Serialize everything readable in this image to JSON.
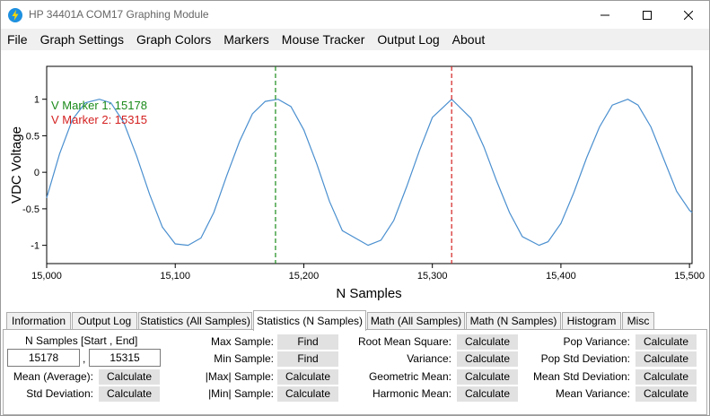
{
  "window": {
    "title": "HP 34401A COM17 Graphing Module",
    "accent": "#1e90e0"
  },
  "menu": [
    "File",
    "Graph Settings",
    "Graph Colors",
    "Markers",
    "Mouse Tracker",
    "Output Log",
    "About"
  ],
  "chart_data": {
    "type": "line",
    "xlabel": "N Samples",
    "ylabel": "VDC Voltage",
    "xlim": [
      15000,
      15502
    ],
    "ylim": [
      -1.25,
      1.45
    ],
    "xticks": [
      15000,
      15100,
      15200,
      15300,
      15400,
      15500
    ],
    "xtick_labels": [
      "15,000",
      "15,100",
      "15,200",
      "15,300",
      "15,400",
      "15,500"
    ],
    "yticks": [
      1,
      0.5,
      0,
      -0.5,
      -1
    ],
    "ytick_labels": [
      "1",
      "0.5",
      "0",
      "-0.5",
      "-1"
    ],
    "grid": false,
    "series": [
      {
        "color": "#4a8fcf",
        "x": [
          15000,
          15010,
          15020,
          15030,
          15041,
          15050,
          15060,
          15070,
          15080,
          15090,
          15100,
          15110,
          15120,
          15130,
          15140,
          15150,
          15160,
          15170,
          15180,
          15190,
          15200,
          15210,
          15220,
          15230,
          15250,
          15260,
          15270,
          15280,
          15290,
          15300,
          15315,
          15330,
          15340,
          15350,
          15360,
          15370,
          15383,
          15390,
          15400,
          15410,
          15420,
          15430,
          15440,
          15452,
          15460,
          15470,
          15480,
          15490,
          15500,
          15502
        ],
        "y": [
          -0.35,
          0.25,
          0.72,
          0.95,
          1.0,
          0.95,
          0.68,
          0.22,
          -0.3,
          -0.75,
          -0.98,
          -1.0,
          -0.9,
          -0.55,
          -0.05,
          0.42,
          0.8,
          0.97,
          1.0,
          0.9,
          0.58,
          0.12,
          -0.4,
          -0.8,
          -1.0,
          -0.93,
          -0.66,
          -0.2,
          0.3,
          0.75,
          1.0,
          0.74,
          0.35,
          -0.12,
          -0.55,
          -0.88,
          -1.0,
          -0.95,
          -0.7,
          -0.28,
          0.2,
          0.62,
          0.92,
          1.0,
          0.92,
          0.62,
          0.18,
          -0.26,
          -0.52,
          -0.55
        ]
      }
    ],
    "markers": [
      {
        "label": "V Marker 1: 15178",
        "x": 15178,
        "color": "#1a8a1a"
      },
      {
        "label": "V Marker 2: 15315",
        "x": 15315,
        "color": "#d42020"
      }
    ]
  },
  "tabs": [
    {
      "label": "Information",
      "active": false
    },
    {
      "label": "Output Log",
      "active": false
    },
    {
      "label": "Statistics (All Samples)",
      "active": false
    },
    {
      "label": "Statistics (N Samples)",
      "active": true
    },
    {
      "label": "Math (All Samples)",
      "active": false
    },
    {
      "label": "Math (N Samples)",
      "active": false
    },
    {
      "label": "Histogram",
      "active": false
    },
    {
      "label": "Misc",
      "active": false
    }
  ],
  "panel": {
    "range_label": "N Samples [Start , End]",
    "start_value": "15178",
    "separator": ",",
    "end_value": "15315",
    "mean_label": "Mean (Average):",
    "std_label": "Std Deviation:",
    "max_label": "Max Sample:",
    "min_label": "Min Sample:",
    "absmax_label": "|Max| Sample:",
    "absmin_label": "|Min| Sample:",
    "rms_label": "Root Mean Square:",
    "variance_label": "Variance:",
    "geomean_label": "Geometric Mean:",
    "harmean_label": "Harmonic Mean:",
    "popvar_label": "Pop Variance:",
    "popstd_label": "Pop Std Deviation:",
    "meanstd_label": "Mean Std Deviation:",
    "meanvar_label": "Mean Variance:",
    "find_label": "Find",
    "calculate_label": "Calculate"
  }
}
